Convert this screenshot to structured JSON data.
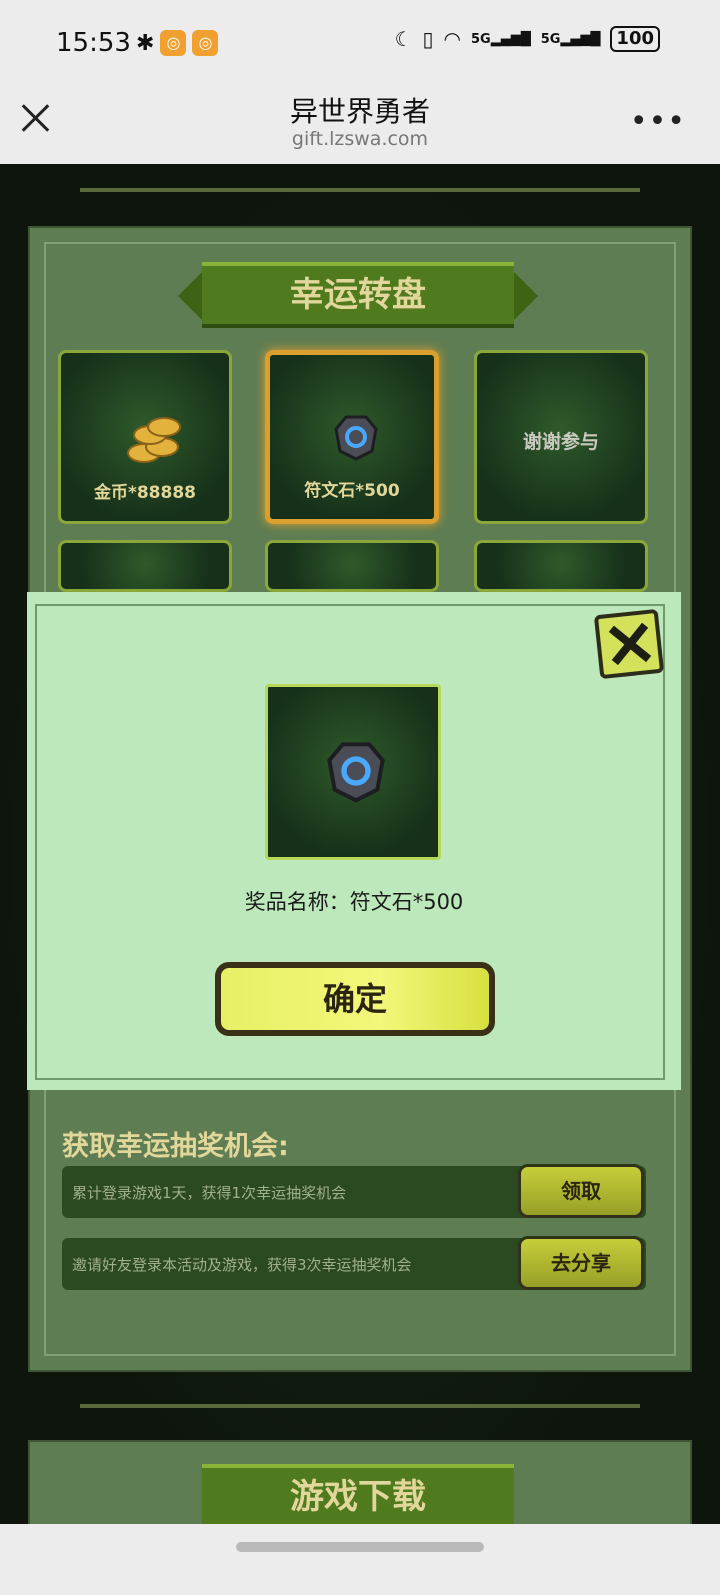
{
  "status_bar": {
    "time": "15:53",
    "battery": "100",
    "signal_1": "5G",
    "signal_2": "5G"
  },
  "nav": {
    "title": "异世界勇者",
    "url": "gift.lzswa.com"
  },
  "wheel": {
    "title": "幸运转盘",
    "tiles": [
      {
        "label": "金币*88888",
        "icon": "gold-coins-icon",
        "selected": false
      },
      {
        "label": "符文石*500",
        "icon": "rune-stone-icon",
        "selected": true
      },
      {
        "label": "谢谢参与",
        "icon": "",
        "selected": false
      }
    ]
  },
  "dialog": {
    "prize_label": "奖品名称：符文石*500",
    "confirm_label": "确定"
  },
  "tasks": {
    "title": "获取幸运抽奖机会:",
    "items": [
      {
        "text": "累计登录游戏1天，获得1次幸运抽奖机会",
        "button": "领取"
      },
      {
        "text": "邀请好友登录本活动及游戏，获得3次幸运抽奖机会",
        "button": "去分享"
      }
    ]
  },
  "download": {
    "title": "游戏下载"
  },
  "colors": {
    "accent_gold": "#e2d79a",
    "dialog_bg": "#bde8bb",
    "button_yellow": "#e7ef66",
    "selected_border": "#d9a030"
  }
}
